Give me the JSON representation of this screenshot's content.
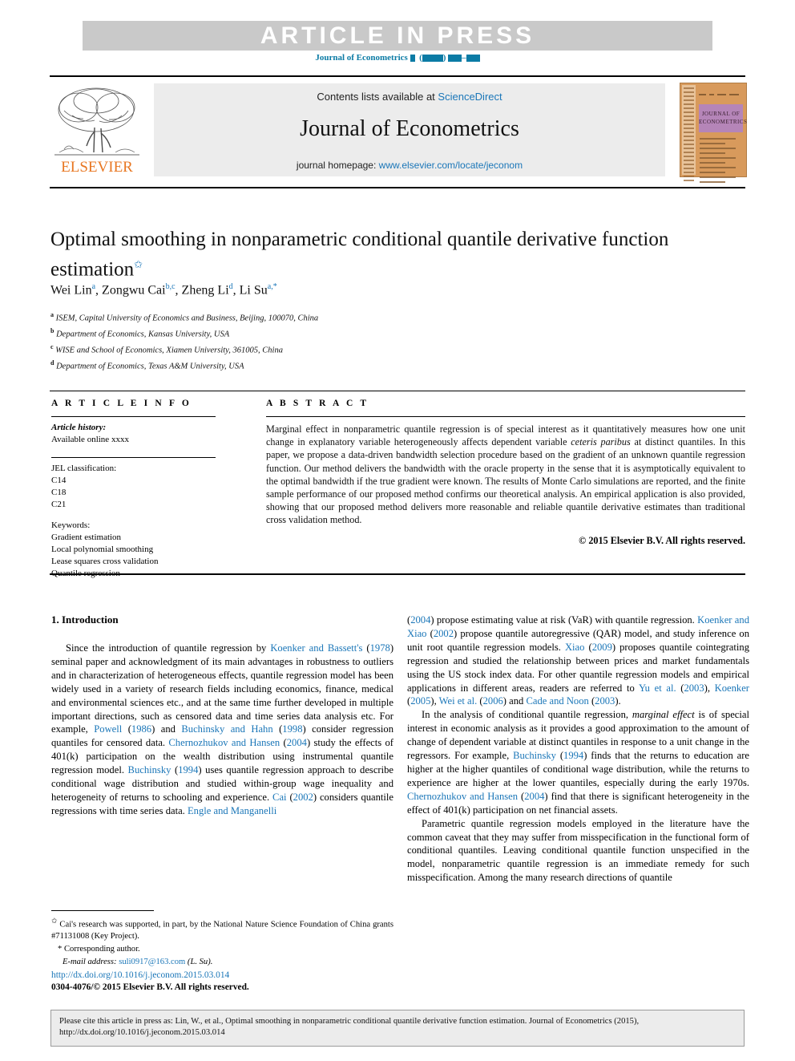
{
  "banner": {
    "article_in_press": "ARTICLE  IN  PRESS",
    "journal_ref_prefix": "Journal of Econometrics"
  },
  "masthead": {
    "contents_label": "Contents lists available at",
    "contents_link": "ScienceDirect",
    "journal_name": "Journal of Econometrics",
    "homepage_label": "journal homepage:",
    "homepage_link": "www.elsevier.com/locate/jeconom",
    "publisher_wordmark": "ELSEVIER",
    "cover_title": "JOURNAL OF ECONOMETRICS"
  },
  "article": {
    "title": "Optimal smoothing in nonparametric conditional quantile derivative function estimation",
    "title_footnote_marker": "✩",
    "authors": "Wei Lin a, Zongwu Cai b,c, Zheng Li d, Li Su a,*",
    "affiliations": [
      {
        "marker": "a",
        "text": "ISEM, Capital University of Economics and Business, Beijing, 100070, China"
      },
      {
        "marker": "b",
        "text": "Department of Economics, Kansas University, USA"
      },
      {
        "marker": "c",
        "text": "WISE and School of Economics, Xiamen University, 361005, China"
      },
      {
        "marker": "d",
        "text": "Department of Economics, Texas A&M University, USA"
      }
    ]
  },
  "info": {
    "heading": "A R T I C L E   I N F O",
    "history_label": "Article history:",
    "history_value": "Available online xxxx",
    "jel_label": "JEL classification:",
    "jel_codes": [
      "C14",
      "C18",
      "C21"
    ],
    "keywords_label": "Keywords:",
    "keywords": [
      "Gradient estimation",
      "Local polynomial smoothing",
      "Lease squares cross validation",
      "Quantile regression"
    ]
  },
  "abstract": {
    "heading": "A B S T R A C T",
    "part1": "Marginal effect in nonparametric quantile regression is of special interest as it quantitatively measures how one unit change in explanatory variable heterogeneously affects dependent variable ",
    "italic": "ceteris paribus",
    "part2": " at distinct quantiles. In this paper, we propose a data-driven bandwidth selection procedure based on the gradient of an unknown quantile regression function. Our method delivers the bandwidth with the oracle property in the sense that it is asymptotically equivalent to the optimal bandwidth if the true gradient were known. The results of Monte Carlo simulations are reported, and the finite sample performance of our proposed method confirms our theoretical analysis. An empirical application is also provided, showing that our proposed method delivers more reasonable and reliable quantile derivative estimates than traditional cross validation method.",
    "copyright": "© 2015 Elsevier B.V. All rights reserved."
  },
  "body": {
    "section_title": "1. Introduction",
    "left_p1_a": "Since the introduction of quantile regression by ",
    "left_c1": "Koenker and Bassett's",
    "left_p1_b": " (",
    "left_c2": "1978",
    "left_p1_c": ") seminal paper and acknowledgment of its main advantages in robustness to outliers and in characterization of heterogeneous effects, quantile regression model has been widely used in a variety of research fields including economics, finance, medical and environmental sciences etc., and at the same time further developed in multiple important directions, such as censored data and time series data analysis etc. For example, ",
    "left_c3": "Powell",
    "left_p1_d": " (",
    "left_c4": "1986",
    "left_p1_e": ") and ",
    "left_c5": "Buchinsky and Hahn",
    "left_p1_f": " (",
    "left_c6": "1998",
    "left_p1_g": ") consider regression quantiles for censored data. ",
    "left_c7": "Chernozhukov and Hansen",
    "left_p1_h": " (",
    "left_c8": "2004",
    "left_p1_i": ") study the effects of 401(k) participation on the wealth distribution using instrumental quantile regression model. ",
    "left_c9": "Buchinsky",
    "left_p1_j": " (",
    "left_c10": "1994",
    "left_p1_k": ") uses quantile regression approach to describe conditional wage distribution and studied within-group wage inequality and heterogeneity of returns to schooling and experience. ",
    "left_c11": "Cai",
    "left_p1_l": " (",
    "left_c12": "2002",
    "left_p1_m": ") considers quantile regressions with time series data. ",
    "left_c13": "Engle and Manganelli",
    "right_p1_a": "(",
    "right_c1": "2004",
    "right_p1_b": ") propose estimating value at risk (VaR) with quantile regression. ",
    "right_c2": "Koenker and Xiao",
    "right_p1_c": " (",
    "right_c3": "2002",
    "right_p1_d": ") propose quantile autoregressive (QAR) model, and study inference on unit root quantile regression models. ",
    "right_c4": "Xiao",
    "right_p1_e": " (",
    "right_c5": "2009",
    "right_p1_f": ") proposes quantile cointegrating regression and studied the relationship between prices and market fundamentals using the US stock index data. For other quantile regression models and empirical applications in different areas, readers are referred to ",
    "right_c6": "Yu et al.",
    "right_p1_g": " (",
    "right_c7": "2003",
    "right_p1_h": "), ",
    "right_c8": "Koenker",
    "right_p1_i": " (",
    "right_c9": "2005",
    "right_p1_j": "), ",
    "right_c10": "Wei et al.",
    "right_p1_k": " (",
    "right_c11": "2006",
    "right_p1_l": ") and ",
    "right_c12": "Cade and Noon",
    "right_p1_m": " (",
    "right_c13": "2003",
    "right_p1_n": ").",
    "right_p2_a": "In the analysis of conditional quantile regression, ",
    "right_p2_italic": "marginal effect",
    "right_p2_b": " is of special interest in economic analysis as it provides a good approximation to the amount of change of dependent variable at distinct quantiles in response to a unit change in the regressors. For example, ",
    "right_c14": "Buchinsky",
    "right_p2_c": " (",
    "right_c15": "1994",
    "right_p2_d": ") finds that the returns to education are higher at the higher quantiles of conditional wage distribution, while the returns to experience are higher at the lower quantiles, especially during the early 1970s. ",
    "right_c16": "Chernozhukov and Hansen",
    "right_p2_e": " (",
    "right_c17": "2004",
    "right_p2_f": ") find that there is significant heterogeneity in the effect of 401(k) participation on net financial assets.",
    "right_p3": "Parametric quantile regression models employed in the literature have the common caveat that they may suffer from misspecification in the functional form of conditional quantiles. Leaving conditional quantile function unspecified in the model, nonparametric quantile regression is an immediate remedy for such misspecification. Among the many research directions of quantile"
  },
  "footnotes": {
    "star_marker": "✩",
    "star_text": "Cai's research was supported, in part, by the National Nature Science Foundation of China grants #71131008 (Key Project).",
    "corr_marker": "*",
    "corr_text": "Corresponding author.",
    "email_label": "E-mail address:",
    "email": "suli0917@163.com",
    "email_owner": "(L. Su).",
    "doi": "http://dx.doi.org/10.1016/j.jeconom.2015.03.014",
    "issn_line": "0304-4076/© 2015 Elsevier B.V. All rights reserved."
  },
  "citation_box": {
    "line1": "Please cite this article in press as: Lin, W., et al., Optimal smoothing in nonparametric conditional quantile derivative function estimation. Journal of Econometrics (2015),",
    "line2": "http://dx.doi.org/10.1016/j.jeconom.2015.03.014"
  },
  "colors": {
    "link": "#1a76b8",
    "banner_bg": "#c9c9c9",
    "masthead_bg": "#ececec",
    "elsevier_orange": "#e87722",
    "journal_ref": "#0b7ba5"
  }
}
